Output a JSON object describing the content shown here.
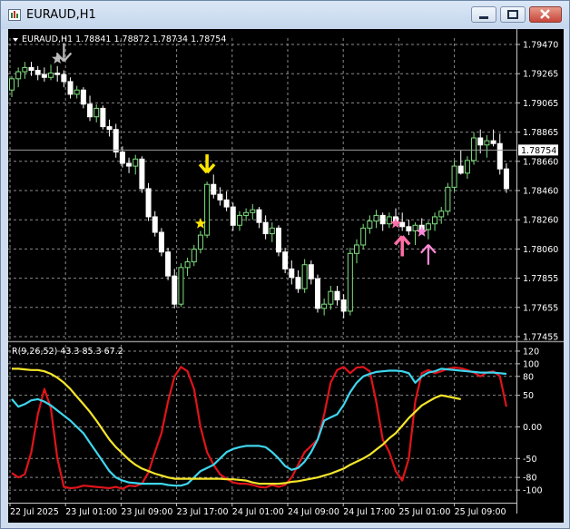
{
  "window": {
    "title": "EURAUD,H1",
    "icon": "chart-window-icon",
    "controls": [
      "minimize-icon",
      "restore-icon",
      "close-icon"
    ]
  },
  "chart_header": {
    "menu_glyph": "triangle-down-icon",
    "text": "EURAUD,H1  1.78841 1.78872 1.78734 1.78754"
  },
  "indicator_label": "R(9,26,52) 43.3 85.3 67.2",
  "current_price": "1.78754",
  "colors": {
    "background": "#000000",
    "bull_candle": "#7fe07f",
    "bear_candle": "#ffffff",
    "grid": "#8a8a8a",
    "price_line": "#9a9a9a",
    "red_line": "#e0141a",
    "cyan_line": "#3fd6ee",
    "yellow_line": "#f6e62a",
    "signal_yellow": "#ffe600",
    "signal_white": "#bcbcbc",
    "signal_pink": "#ff6fa6",
    "signal_violet": "#ff8ad8"
  },
  "chart_data": [
    {
      "type": "candlestick",
      "symbol": "EURAUD",
      "timeframe": "H1",
      "price_axis_ticks": [
        "1.79470",
        "1.79265",
        "1.79065",
        "1.78865",
        "1.78660",
        "1.78460",
        "1.78260",
        "1.78060",
        "1.77855",
        "1.77655",
        "1.77455"
      ],
      "ylim": [
        1.7741,
        1.7951
      ],
      "time_axis_labels": [
        "22 Jul 2025",
        "23 Jul 01:00",
        "23 Jul 09:00",
        "23 Jul 17:00",
        "24 Jul 01:00",
        "24 Jul 09:00",
        "24 Jul 17:00",
        "25 Jul 01:00",
        "25 Jul 09:00"
      ],
      "candles": [
        [
          1.7918,
          1.7928,
          1.7913,
          1.7926
        ],
        [
          1.7926,
          1.7934,
          1.792,
          1.7931
        ],
        [
          1.7931,
          1.7938,
          1.7926,
          1.7934
        ],
        [
          1.7934,
          1.7938,
          1.7928,
          1.7932
        ],
        [
          1.7932,
          1.7935,
          1.7925,
          1.7929
        ],
        [
          1.7929,
          1.7934,
          1.7924,
          1.7927
        ],
        [
          1.7927,
          1.7936,
          1.7925,
          1.793
        ],
        [
          1.793,
          1.7935,
          1.7924,
          1.7929
        ],
        [
          1.7929,
          1.7932,
          1.792,
          1.7924
        ],
        [
          1.7924,
          1.7927,
          1.7912,
          1.7915
        ],
        [
          1.7915,
          1.7921,
          1.7912,
          1.7918
        ],
        [
          1.7918,
          1.792,
          1.7905,
          1.7908
        ],
        [
          1.7908,
          1.7914,
          1.7896,
          1.7899
        ],
        [
          1.7899,
          1.7908,
          1.7895,
          1.7905
        ],
        [
          1.7905,
          1.7907,
          1.789,
          1.7892
        ],
        [
          1.7892,
          1.7897,
          1.7885,
          1.789
        ],
        [
          1.789,
          1.7894,
          1.787,
          1.7874
        ],
        [
          1.7874,
          1.7878,
          1.7863,
          1.7866
        ],
        [
          1.7866,
          1.787,
          1.7859,
          1.7864
        ],
        [
          1.7864,
          1.7872,
          1.7858,
          1.7869
        ],
        [
          1.7869,
          1.7871,
          1.7845,
          1.7848
        ],
        [
          1.7848,
          1.7852,
          1.7825,
          1.7828
        ],
        [
          1.7828,
          1.7832,
          1.7814,
          1.7817
        ],
        [
          1.7817,
          1.782,
          1.78,
          1.7803
        ],
        [
          1.7803,
          1.7806,
          1.7783,
          1.7786
        ],
        [
          1.7786,
          1.7791,
          1.7763,
          1.7766
        ],
        [
          1.7766,
          1.7795,
          1.7764,
          1.7792
        ],
        [
          1.7792,
          1.7799,
          1.7786,
          1.7796
        ],
        [
          1.7796,
          1.7808,
          1.7793,
          1.7805
        ],
        [
          1.7805,
          1.7818,
          1.7802,
          1.7815
        ],
        [
          1.7815,
          1.7853,
          1.7813,
          1.7851
        ],
        [
          1.7851,
          1.7858,
          1.7841,
          1.7844
        ],
        [
          1.7844,
          1.7849,
          1.7836,
          1.784
        ],
        [
          1.784,
          1.7846,
          1.7832,
          1.7835
        ],
        [
          1.7835,
          1.7838,
          1.7818,
          1.7822
        ],
        [
          1.7822,
          1.7832,
          1.7818,
          1.7829
        ],
        [
          1.7829,
          1.7834,
          1.7825,
          1.7831
        ],
        [
          1.7831,
          1.7837,
          1.7826,
          1.7833
        ],
        [
          1.7833,
          1.7835,
          1.782,
          1.7824
        ],
        [
          1.7824,
          1.7829,
          1.7812,
          1.7816
        ],
        [
          1.7816,
          1.7824,
          1.781,
          1.782
        ],
        [
          1.782,
          1.7822,
          1.78,
          1.7803
        ],
        [
          1.7803,
          1.7806,
          1.7788,
          1.7791
        ],
        [
          1.7791,
          1.7797,
          1.778,
          1.7785
        ],
        [
          1.7785,
          1.779,
          1.7774,
          1.7777
        ],
        [
          1.7777,
          1.7798,
          1.7774,
          1.7794
        ],
        [
          1.7794,
          1.7797,
          1.778,
          1.7784
        ],
        [
          1.7784,
          1.7787,
          1.776,
          1.7763
        ],
        [
          1.7763,
          1.777,
          1.7758,
          1.7766
        ],
        [
          1.7766,
          1.7779,
          1.7762,
          1.7775
        ],
        [
          1.7775,
          1.7779,
          1.7765,
          1.7769
        ],
        [
          1.7769,
          1.7773,
          1.7756,
          1.7761
        ],
        [
          1.7761,
          1.7806,
          1.7758,
          1.7802
        ],
        [
          1.7802,
          1.7812,
          1.7795,
          1.7808
        ],
        [
          1.7808,
          1.7823,
          1.7805,
          1.782
        ],
        [
          1.782,
          1.7829,
          1.7816,
          1.7825
        ],
        [
          1.7825,
          1.7833,
          1.782,
          1.7829
        ],
        [
          1.7829,
          1.7831,
          1.7818,
          1.7823
        ],
        [
          1.7823,
          1.7831,
          1.782,
          1.7828
        ],
        [
          1.7828,
          1.7834,
          1.7822,
          1.7824
        ],
        [
          1.7824,
          1.7831,
          1.7818,
          1.7821
        ],
        [
          1.7821,
          1.7826,
          1.7815,
          1.7818
        ],
        [
          1.7818,
          1.7824,
          1.7808,
          1.7822
        ],
        [
          1.7822,
          1.7827,
          1.7816,
          1.7819
        ],
        [
          1.7819,
          1.7825,
          1.7812,
          1.7823
        ],
        [
          1.7823,
          1.7831,
          1.7818,
          1.7828
        ],
        [
          1.7828,
          1.7835,
          1.7823,
          1.7832
        ],
        [
          1.7832,
          1.7852,
          1.7829,
          1.7849
        ],
        [
          1.7849,
          1.7868,
          1.7846,
          1.7864
        ],
        [
          1.7864,
          1.7875,
          1.7858,
          1.7859
        ],
        [
          1.7859,
          1.7871,
          1.7855,
          1.7868
        ],
        [
          1.7868,
          1.7888,
          1.7865,
          1.7884
        ],
        [
          1.7884,
          1.789,
          1.7873,
          1.7879
        ],
        [
          1.7879,
          1.7886,
          1.787,
          1.7882
        ],
        [
          1.7882,
          1.789,
          1.7878,
          1.788
        ],
        [
          1.788,
          1.7887,
          1.7858,
          1.7862
        ],
        [
          1.7862,
          1.7866,
          1.7845,
          1.7848
        ]
      ],
      "signals": [
        {
          "candle_index": 8,
          "kind": "arrow-down",
          "color": "#bcbcbc"
        },
        {
          "candle_index": 7,
          "kind": "star",
          "color": "#bcbcbc"
        },
        {
          "candle_index": 30,
          "kind": "arrow-down",
          "color": "#ffe600"
        },
        {
          "candle_index": 29,
          "kind": "star",
          "color": "#ffe600"
        },
        {
          "candle_index": 60,
          "kind": "arrow-up",
          "color": "#ff6fa6"
        },
        {
          "candle_index": 59,
          "kind": "star",
          "color": "#ff6fa6"
        },
        {
          "candle_index": 64,
          "kind": "arrow-up",
          "color": "#ff8ad8"
        },
        {
          "candle_index": 63,
          "kind": "star",
          "color": "#ff8ad8"
        }
      ]
    },
    {
      "type": "line",
      "name": "R(9,26,52)",
      "y_axis_ticks": [
        "120",
        "100",
        "80",
        "50",
        "0.00",
        "-50",
        "-80",
        "-100"
      ],
      "ylim": [
        -120,
        130
      ],
      "x": "candle index (0-76)",
      "series": [
        {
          "key": "red",
          "color": "#e0141a",
          "values": [
            -73,
            -80,
            -75,
            -40,
            20,
            60,
            30,
            -50,
            -95,
            -97,
            -96,
            -93,
            -94,
            -95,
            -96,
            -97,
            -95,
            -98,
            -93,
            -94,
            -90,
            -72,
            -40,
            -10,
            40,
            80,
            95,
            88,
            60,
            0,
            -40,
            -60,
            -75,
            -82,
            -88,
            -90,
            -90,
            -92,
            -95,
            -96,
            -92,
            -95,
            -92,
            -80,
            -60,
            -40,
            -30,
            -20,
            20,
            70,
            90,
            95,
            85,
            94,
            95,
            88,
            40,
            -20,
            -40,
            -70,
            -85,
            -50,
            40,
            85,
            90,
            85,
            88,
            92,
            94,
            93,
            90,
            86,
            80,
            86,
            88,
            80,
            32
          ]
        },
        {
          "key": "cyan",
          "color": "#3fd6ee",
          "values": [
            44,
            32,
            36,
            42,
            44,
            40,
            34,
            26,
            18,
            10,
            0,
            -10,
            -25,
            -40,
            -55,
            -70,
            -80,
            -85,
            -88,
            -89,
            -90,
            -90,
            -90,
            -90,
            -92,
            -93,
            -93,
            -90,
            -80,
            -70,
            -65,
            -60,
            -50,
            -40,
            -35,
            -32,
            -30,
            -30,
            -30,
            -32,
            -40,
            -50,
            -62,
            -68,
            -65,
            -55,
            -40,
            -20,
            10,
            15,
            20,
            35,
            55,
            70,
            80,
            84,
            87,
            88,
            89,
            89,
            88,
            85,
            70,
            80,
            86,
            88,
            92,
            91,
            90,
            89,
            88,
            87,
            86,
            86,
            86,
            85,
            84
          ]
        },
        {
          "key": "yellow",
          "color": "#f6e62a",
          "values": [
            92,
            92,
            91,
            90,
            90,
            88,
            84,
            78,
            70,
            60,
            48,
            36,
            24,
            10,
            -5,
            -20,
            -32,
            -42,
            -52,
            -60,
            -66,
            -70,
            -74,
            -77,
            -80,
            -82,
            -82,
            -82,
            -82,
            -82,
            -82,
            -82,
            -82,
            -83,
            -83,
            -84,
            -85,
            -88,
            -90,
            -90,
            -90,
            -90,
            -89,
            -87,
            -86,
            -84,
            -82,
            -80,
            -77,
            -74,
            -70,
            -66,
            -60,
            -55,
            -50,
            -44,
            -36,
            -28,
            -18,
            -10,
            2,
            14,
            24,
            34,
            40,
            46,
            50,
            48,
            46,
            44
          ]
        }
      ]
    }
  ]
}
